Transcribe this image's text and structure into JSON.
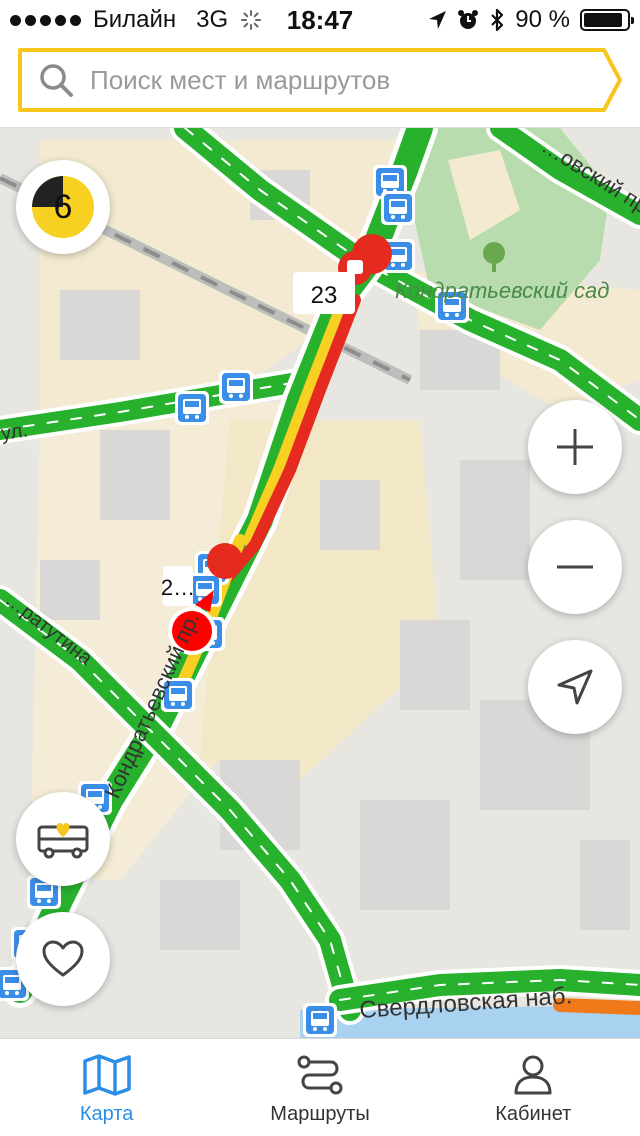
{
  "status_bar": {
    "carrier": "Билайн",
    "network": "3G",
    "time": "18:47",
    "battery": "90 %",
    "battery_level": 0.9
  },
  "search": {
    "placeholder": "Поиск мест и маршрутов",
    "value": ""
  },
  "map": {
    "traffic_score": "6",
    "place_labels": [
      "Кондратьевский сад"
    ],
    "street_labels": [
      "Свердловская наб.",
      "Кондратьевский пр.",
      "ул.",
      "…ратутина",
      "…овский пр…"
    ],
    "bus_route_label": "23",
    "bus_route_label_2": "2…"
  },
  "controls": {
    "zoom_in": "+",
    "zoom_out": "−"
  },
  "tabs": [
    {
      "label": "Карта",
      "active": true
    },
    {
      "label": "Маршруты",
      "active": false
    },
    {
      "label": "Кабинет",
      "active": false
    }
  ],
  "colors": {
    "accent": "#2a8ee6",
    "search_border": "#f8c51c",
    "traffic_green": "#27b12d",
    "traffic_red": "#e52a20",
    "traffic_yellow": "#f8d022",
    "stop_blue": "#3b8ee8"
  }
}
